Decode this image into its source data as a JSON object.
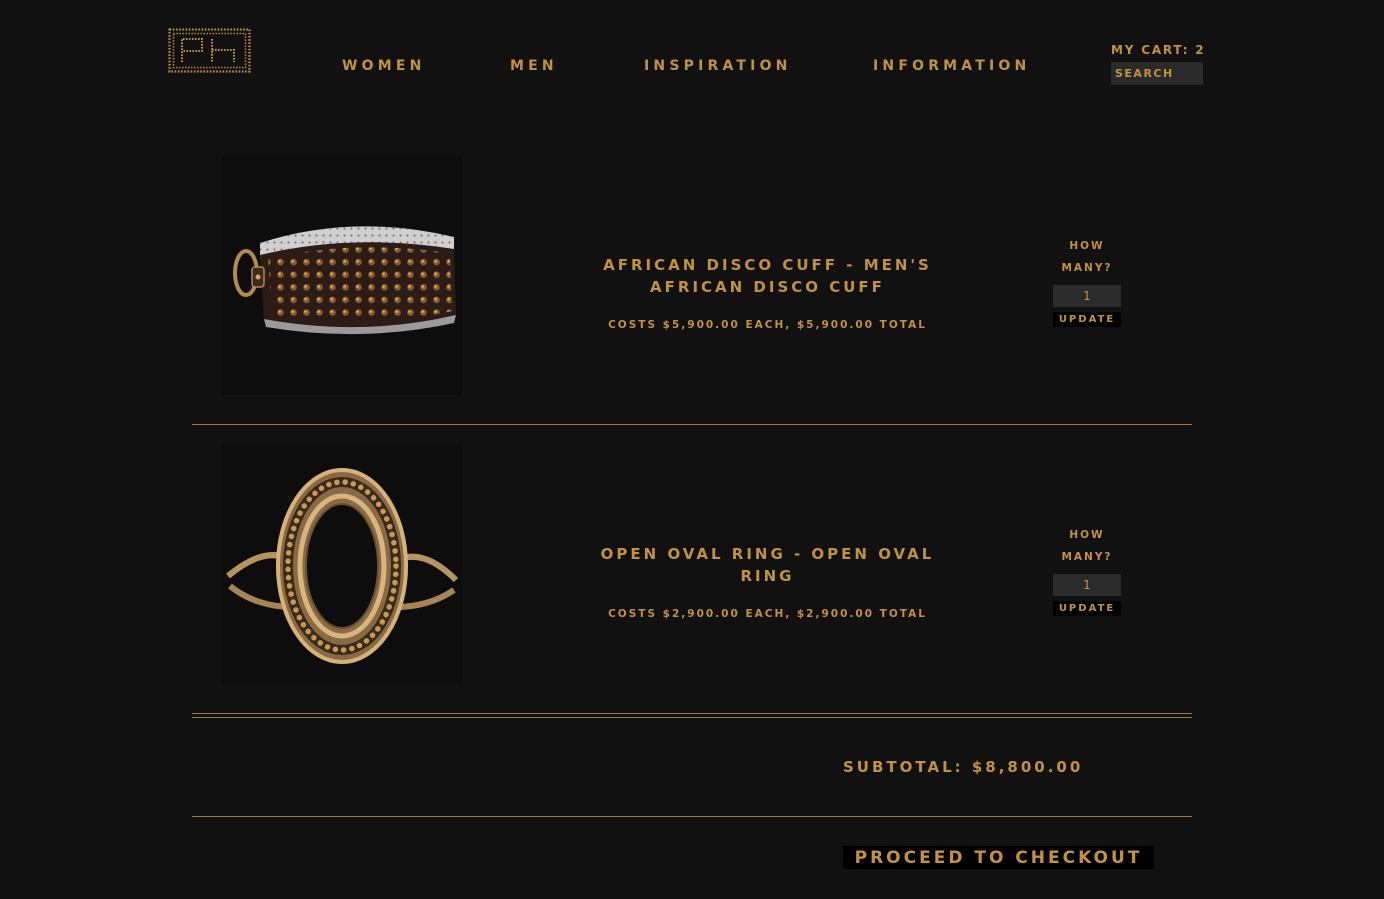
{
  "header": {
    "logo_text": "PH",
    "nav": [
      {
        "label": "WOMEN"
      },
      {
        "label": "MEN"
      },
      {
        "label": "INSPIRATION"
      },
      {
        "label": "INFORMATION"
      }
    ],
    "cart_label": "MY CART: 2",
    "search_placeholder": "SEARCH"
  },
  "cart": {
    "items": [
      {
        "name": "AFRICAN DISCO CUFF - MEN'S AFRICAN DISCO CUFF",
        "price_line": "COSTS $5,900.00 EACH, $5,900.00 TOTAL",
        "qty_label": "HOW MANY?",
        "qty_value": "1",
        "update_label": "UPDATE",
        "image_icon": "cuff-bracelet-image"
      },
      {
        "name": "OPEN OVAL RING - OPEN OVAL RING",
        "price_line": "COSTS $2,900.00 EACH, $2,900.00 TOTAL",
        "qty_label": "HOW MANY?",
        "qty_value": "1",
        "update_label": "UPDATE",
        "image_icon": "oval-ring-image"
      }
    ],
    "subtotal": "SUBTOTAL: $8,800.00",
    "checkout_label": "PROCEED TO CHECKOUT"
  },
  "colors": {
    "background": "#111111",
    "accent": "#c4923f",
    "rule": "#a07836",
    "input_bg": "#2b2b2b"
  }
}
